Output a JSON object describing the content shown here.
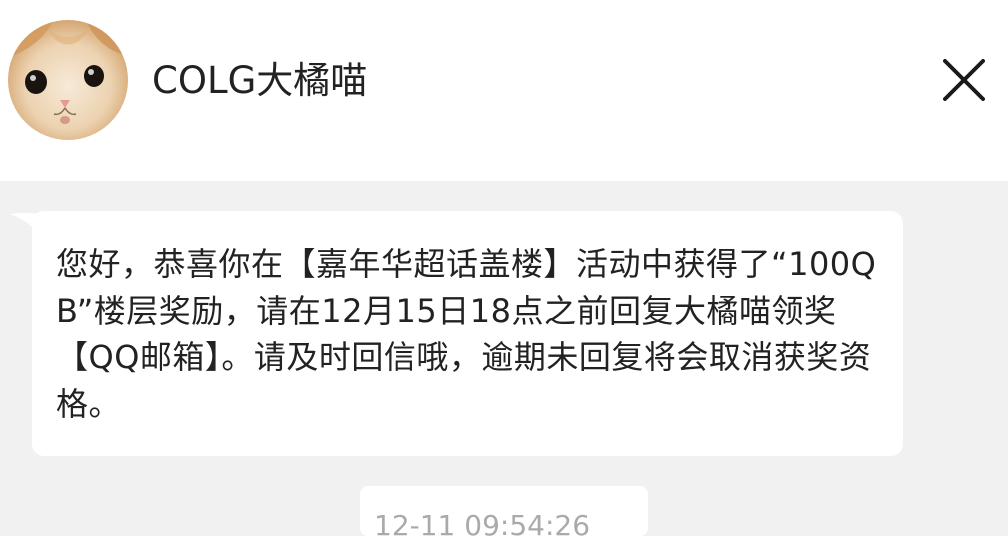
{
  "header": {
    "contact_name": "COLG大橘喵",
    "avatar_icon": "cat-avatar-icon",
    "close_icon": "close-icon"
  },
  "messages": [
    {
      "text": "您好，恭喜你在【嘉年华超话盖楼】活动中获得了“100QB”楼层奖励，请在12月15日18点之前回复大橘喵领奖【QQ邮箱】。请及时回信哦，逾期未回复将会取消获奖资格。"
    }
  ],
  "timestamp": "12-11 09:54:26",
  "colors": {
    "chat_background": "#f1f1f1",
    "bubble_background": "#ffffff",
    "text": "#222222",
    "timestamp_text": "#aaaaaa"
  }
}
